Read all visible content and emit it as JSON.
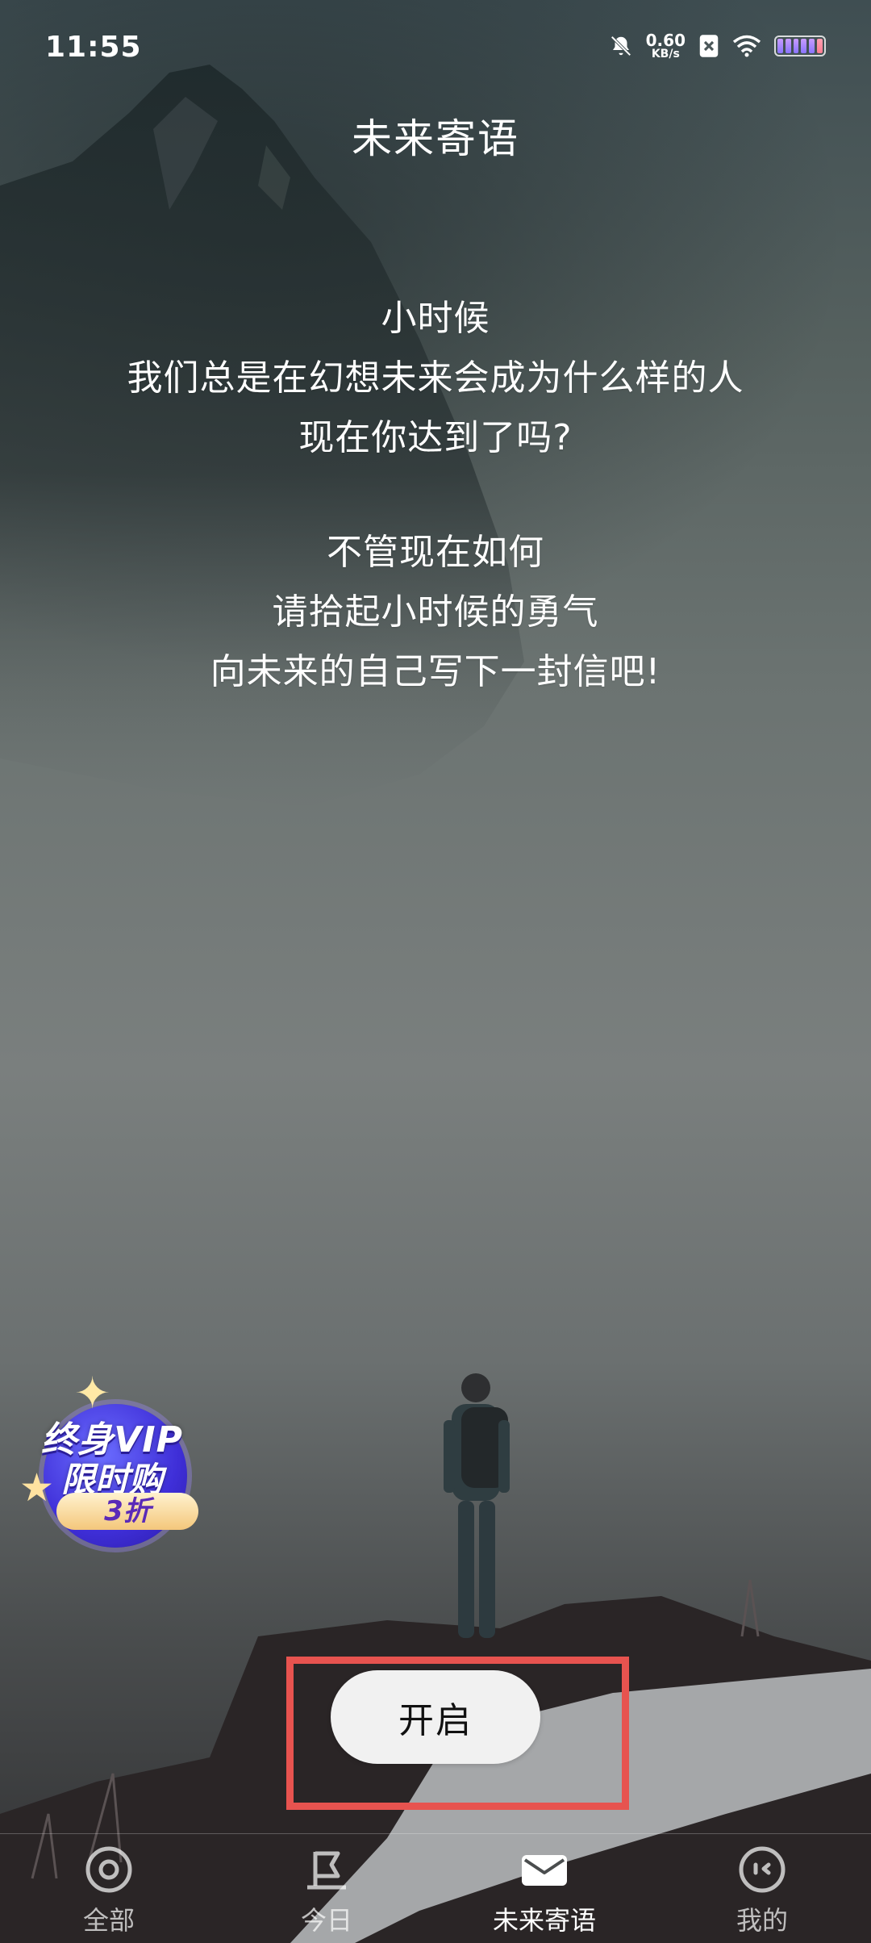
{
  "status_bar": {
    "time": "11:55",
    "net_speed_value": "0.60",
    "net_speed_unit": "KB/s",
    "icons": [
      "bell-off-icon",
      "sim-icon",
      "wifi-icon",
      "battery-icon"
    ]
  },
  "page": {
    "title": "未来寄语",
    "message": {
      "para1": [
        "小时候",
        "我们总是在幻想未来会成为什么样的人",
        "现在你达到了吗?"
      ],
      "para2": [
        "不管现在如何",
        "请拾起小时候的勇气",
        "向未来的自己写下一封信吧!"
      ]
    },
    "open_button_label": "开启"
  },
  "vip_badge": {
    "line1": "终身VIP",
    "line2": "限时购",
    "discount": "3折"
  },
  "bottom_nav": {
    "items": [
      {
        "label": "全部",
        "icon": "target-icon",
        "active": false
      },
      {
        "label": "今日",
        "icon": "flag-icon",
        "active": false
      },
      {
        "label": "未来寄语",
        "icon": "envelope-icon",
        "active": true
      },
      {
        "label": "我的",
        "icon": "smiley-icon",
        "active": false
      }
    ]
  },
  "colors": {
    "highlight": "#e7534f",
    "button_bg": "#f1f1f1",
    "vip_purple": "#3f2fd8"
  }
}
